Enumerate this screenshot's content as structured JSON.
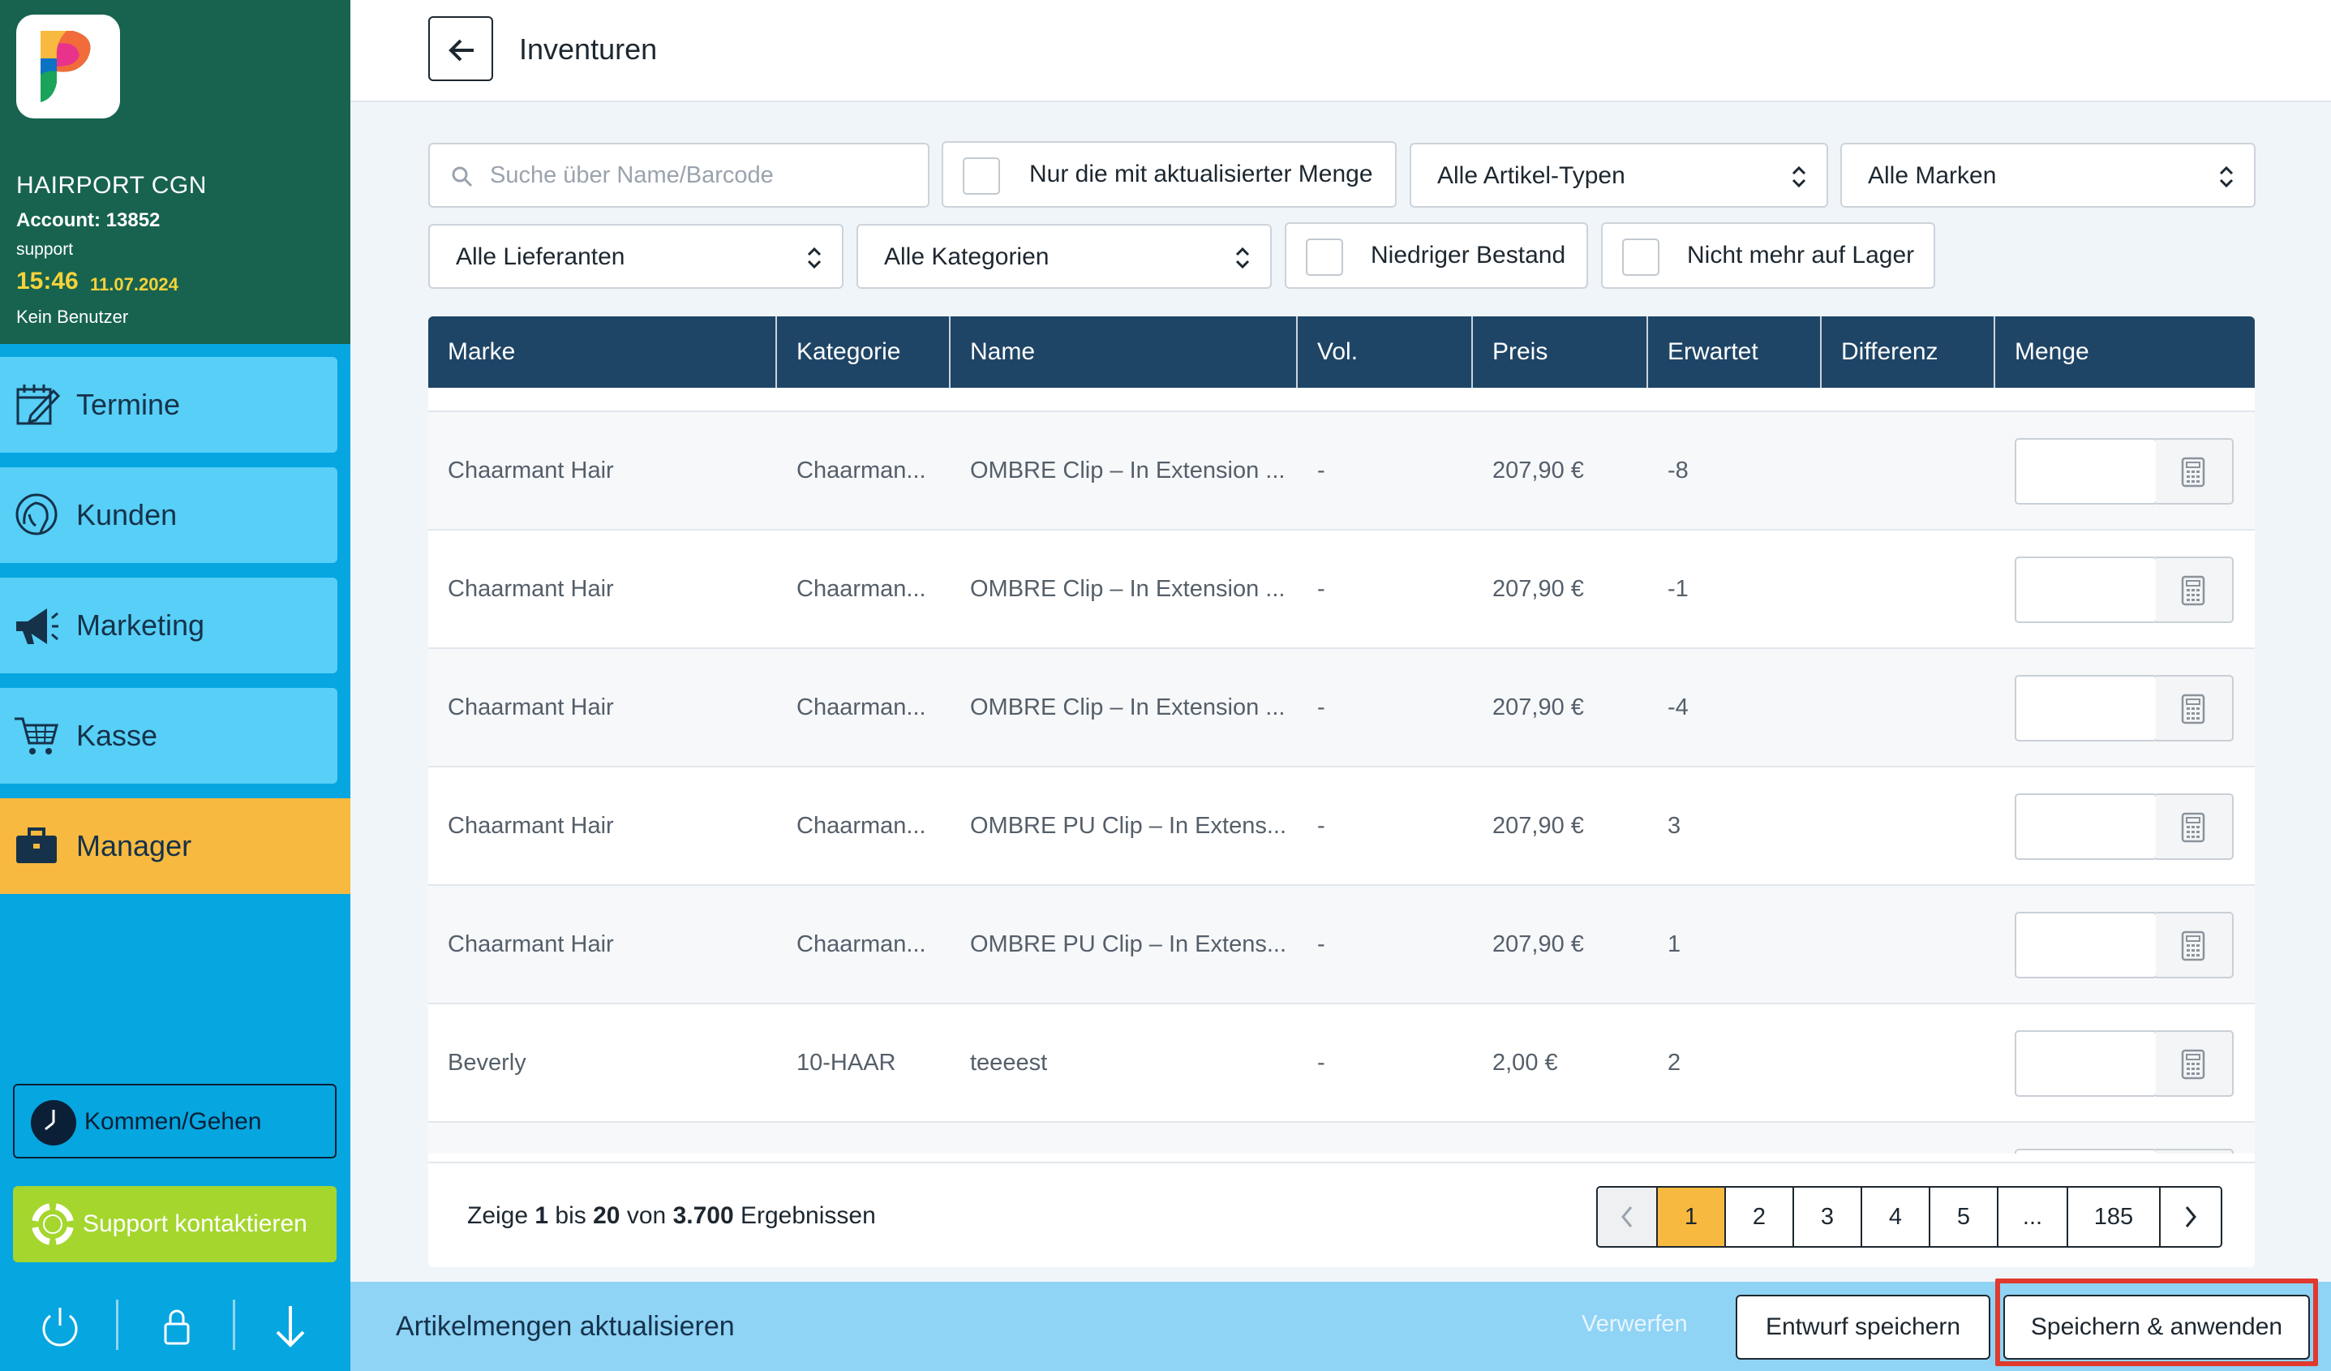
{
  "sidebar": {
    "salon_name": "HAIRPORT CGN",
    "account": "Account: 13852",
    "role": "support",
    "time": "15:46",
    "date": "11.07.2024",
    "user": "Kein Benutzer",
    "nav": [
      {
        "label": "Termine",
        "icon": "calendar-edit-icon"
      },
      {
        "label": "Kunden",
        "icon": "customer-head-icon"
      },
      {
        "label": "Marketing",
        "icon": "megaphone-icon"
      },
      {
        "label": "Kasse",
        "icon": "shopping-cart-icon"
      },
      {
        "label": "Manager",
        "icon": "briefcase-icon",
        "active": true
      }
    ],
    "clock_button": "Kommen/Gehen",
    "support_button": "Support kontaktieren"
  },
  "header": {
    "title": "Inventuren"
  },
  "filters": {
    "search_placeholder": "Suche über Name/Barcode",
    "only_updated": "Nur die mit aktualisierter Menge",
    "article_types": "Alle Artikel-Typen",
    "brands": "Alle Marken",
    "suppliers": "Alle Lieferanten",
    "categories": "Alle Kategorien",
    "low_stock": "Niedriger Bestand",
    "out_of_stock": "Nicht mehr auf Lager"
  },
  "table": {
    "columns": [
      "Marke",
      "Kategorie",
      "Name",
      "Vol.",
      "Preis",
      "Erwartet",
      "Differenz",
      "Menge"
    ],
    "rows": [
      {
        "marke": "Chaarmant Hair",
        "kategorie": "Chaarman...",
        "name": "OMBRE Clip – In Extension ...",
        "vol": "-",
        "preis": "207,90 €",
        "erwartet": "-8",
        "differenz": ""
      },
      {
        "marke": "Chaarmant Hair",
        "kategorie": "Chaarman...",
        "name": "OMBRE Clip – In Extension ...",
        "vol": "-",
        "preis": "207,90 €",
        "erwartet": "-1",
        "differenz": ""
      },
      {
        "marke": "Chaarmant Hair",
        "kategorie": "Chaarman...",
        "name": "OMBRE Clip – In Extension ...",
        "vol": "-",
        "preis": "207,90 €",
        "erwartet": "-4",
        "differenz": ""
      },
      {
        "marke": "Chaarmant Hair",
        "kategorie": "Chaarman...",
        "name": "OMBRE PU Clip – In Extens...",
        "vol": "-",
        "preis": "207,90 €",
        "erwartet": "3",
        "differenz": ""
      },
      {
        "marke": "Chaarmant Hair",
        "kategorie": "Chaarman...",
        "name": "OMBRE PU Clip – In Extens...",
        "vol": "-",
        "preis": "207,90 €",
        "erwartet": "1",
        "differenz": ""
      },
      {
        "marke": "Beverly",
        "kategorie": "10-HAAR",
        "name": "teeeest",
        "vol": "-",
        "preis": "2,00 €",
        "erwartet": "2",
        "differenz": ""
      }
    ]
  },
  "footer": {
    "results_prefix": "Zeige",
    "results_from": "1",
    "results_bis": "bis",
    "results_to": "20",
    "results_von": "von",
    "results_total": "3.700",
    "results_suffix": "Ergebnissen",
    "pages": [
      "1",
      "2",
      "3",
      "4",
      "5",
      "...",
      "185"
    ],
    "current_page": "1"
  },
  "action_bar": {
    "title": "Artikelmengen aktualisieren",
    "discard": "Verwerfen",
    "save_draft": "Entwurf speichern",
    "save_apply": "Speichern & anwenden"
  },
  "colors": {
    "sidebar_header": "#17634f",
    "sidebar_bg": "#06a6e0",
    "nav_item": "#57cff7",
    "nav_active": "#f7b93f",
    "table_header": "#1f4566",
    "support_green": "#a4d62e",
    "action_bar": "#8fd3f5",
    "highlight_red": "#e03a2e"
  }
}
